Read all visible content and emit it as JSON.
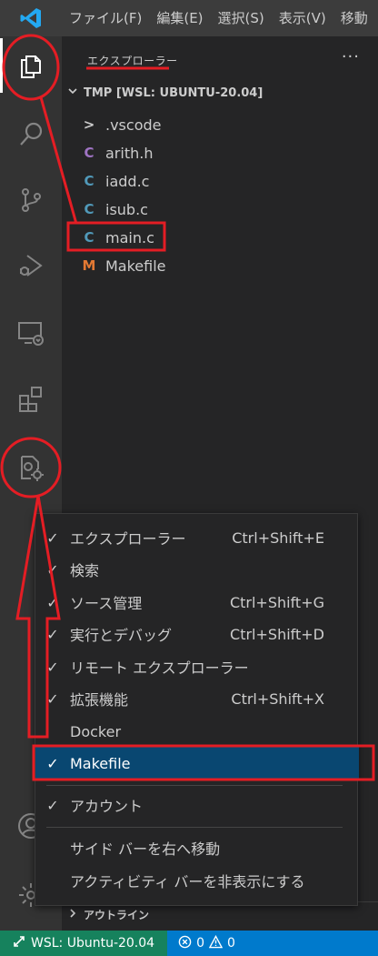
{
  "menubar": {
    "items": [
      "ファイル(F)",
      "編集(E)",
      "選択(S)",
      "表示(V)",
      "移動"
    ]
  },
  "activitybar": {
    "icons": [
      "explorer-icon",
      "search-icon",
      "source-control-icon",
      "run-debug-icon",
      "remote-explorer-icon",
      "extensions-icon",
      "makefile-icon",
      "account-icon",
      "manage-gear-icon"
    ]
  },
  "sidebar": {
    "title": "エクスプローラー",
    "more_label": "···",
    "folder_name": "TMP [WSL: UBUNTU-20.04]",
    "items": [
      {
        "label": ".vscode",
        "icon": ">",
        "color": "#cccccc"
      },
      {
        "label": "arith.h",
        "icon": "C",
        "color": "#a074c4"
      },
      {
        "label": "iadd.c",
        "icon": "C",
        "color": "#519aba"
      },
      {
        "label": "isub.c",
        "icon": "C",
        "color": "#519aba"
      },
      {
        "label": "main.c",
        "icon": "C",
        "color": "#519aba"
      },
      {
        "label": "Makefile",
        "icon": "M",
        "color": "#e37933"
      }
    ],
    "outline_label": "アウトライン"
  },
  "context_menu": {
    "items": [
      {
        "check": "✓",
        "label": "エクスプローラー",
        "shortcut": "Ctrl+Shift+E"
      },
      {
        "check": "✓",
        "label": "検索",
        "shortcut": ""
      },
      {
        "check": "✓",
        "label": "ソース管理",
        "shortcut": "Ctrl+Shift+G"
      },
      {
        "check": "✓",
        "label": "実行とデバッグ",
        "shortcut": "Ctrl+Shift+D"
      },
      {
        "check": "✓",
        "label": "リモート エクスプローラー",
        "shortcut": ""
      },
      {
        "check": "✓",
        "label": "拡張機能",
        "shortcut": "Ctrl+Shift+X"
      },
      {
        "check": "",
        "label": "Docker",
        "shortcut": ""
      },
      {
        "check": "✓",
        "label": "Makefile",
        "shortcut": ""
      },
      {
        "check": "✓",
        "label": "アカウント",
        "shortcut": ""
      },
      {
        "check": "",
        "label": "サイド バーを右へ移動",
        "shortcut": ""
      },
      {
        "check": "",
        "label": "アクティビティ バーを非表示にする",
        "shortcut": ""
      }
    ]
  },
  "statusbar": {
    "remote_label": "WSL: Ubuntu-20.04",
    "errors": "0",
    "warnings": "0"
  },
  "colors": {
    "annotation_red": "#e41d24",
    "highlight": "#094771",
    "status_blue": "#007acc",
    "remote_green": "#16825d"
  }
}
